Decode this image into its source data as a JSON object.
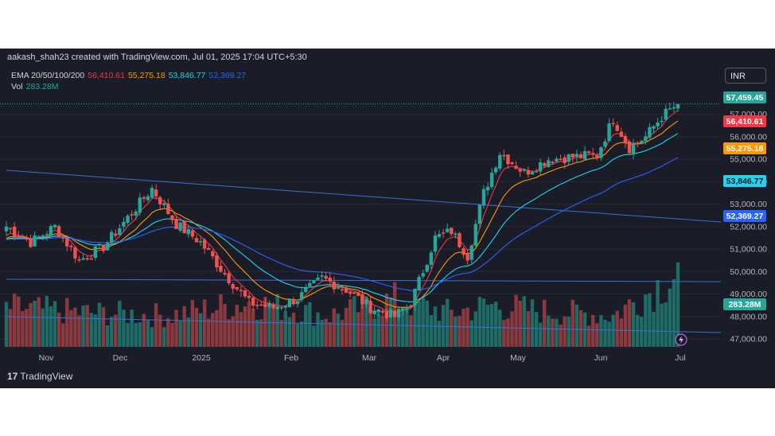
{
  "header": {
    "credit": "aakash_shah23 created with TradingView.com, Jul 01, 2025 17:04 UTC+5:30"
  },
  "legend": {
    "ema_label": "EMA 20/50/100/200",
    "ema20": "56,410.61",
    "ema50": "55,275.18",
    "ema100": "53,846.77",
    "ema200": "52,369.27",
    "vol_label": "Vol",
    "vol_value": "283.28M"
  },
  "currency": "INR",
  "branding": {
    "logo": "17",
    "name": "TradingView"
  },
  "colors": {
    "up": "#26a69a",
    "down": "#ef5350",
    "ema20": "#f23645",
    "ema50": "#ff9800",
    "ema100": "#22d3ee",
    "ema200": "#2962ff",
    "trend": "#3b6fd8",
    "bg": "#1a1d27"
  },
  "chart_data": {
    "type": "candlestick",
    "y_axis": {
      "min": 47000,
      "max": 57800,
      "ticks": [
        47000,
        48000,
        49000,
        50000,
        51000,
        52000,
        53000,
        54000,
        55000,
        56000,
        57000
      ]
    },
    "x_axis": {
      "ticks": [
        "Nov",
        "Dec",
        "2025",
        "Feb",
        "Mar",
        "Apr",
        "May",
        "Jun",
        "Jul"
      ]
    },
    "price_labels": [
      {
        "text": "57,459.45",
        "value": 57459.45,
        "color": "#26a69a"
      },
      {
        "text": "56,410.61",
        "value": 56410.61,
        "color": "#f23645"
      },
      {
        "text": "55,275.18",
        "value": 55275.18,
        "color": "#ff9800"
      },
      {
        "text": "53,846.77",
        "value": 53846.77,
        "color": "#22d3ee"
      },
      {
        "text": "52,369.27",
        "value": 52369.27,
        "color": "#2962ff"
      },
      {
        "text": "283.28M",
        "value": 283.28,
        "color": "#26a69a"
      }
    ],
    "close_anchors": [
      [
        0,
        52000
      ],
      [
        6,
        51300
      ],
      [
        12,
        52000
      ],
      [
        18,
        50500
      ],
      [
        24,
        51100
      ],
      [
        30,
        52400
      ],
      [
        36,
        53700
      ],
      [
        42,
        52100
      ],
      [
        48,
        51300
      ],
      [
        54,
        49900
      ],
      [
        60,
        48600
      ],
      [
        66,
        48400
      ],
      [
        72,
        48800
      ],
      [
        78,
        49700
      ],
      [
        84,
        49200
      ],
      [
        90,
        48400
      ],
      [
        96,
        48000
      ],
      [
        100,
        48600
      ],
      [
        106,
        51500
      ],
      [
        110,
        51800
      ],
      [
        114,
        50700
      ],
      [
        118,
        53500
      ],
      [
        122,
        55300
      ],
      [
        128,
        54400
      ],
      [
        134,
        55000
      ],
      [
        140,
        55100
      ],
      [
        146,
        55200
      ],
      [
        150,
        56800
      ],
      [
        154,
        55500
      ],
      [
        158,
        56000
      ],
      [
        162,
        56900
      ],
      [
        166,
        57459
      ]
    ],
    "volume_anchors": [
      [
        0,
        150
      ],
      [
        20,
        130
      ],
      [
        40,
        120
      ],
      [
        60,
        170
      ],
      [
        80,
        120
      ],
      [
        96,
        180
      ],
      [
        110,
        130
      ],
      [
        120,
        160
      ],
      [
        130,
        140
      ],
      [
        150,
        120
      ],
      [
        166,
        283
      ]
    ],
    "series": [
      {
        "name": "EMA 20",
        "value": 56410.61
      },
      {
        "name": "EMA 50",
        "value": 55275.18
      },
      {
        "name": "EMA 100",
        "value": 53846.77
      },
      {
        "name": "EMA 200",
        "value": 52369.27
      },
      {
        "name": "Vol",
        "value": "283.28M"
      }
    ]
  }
}
